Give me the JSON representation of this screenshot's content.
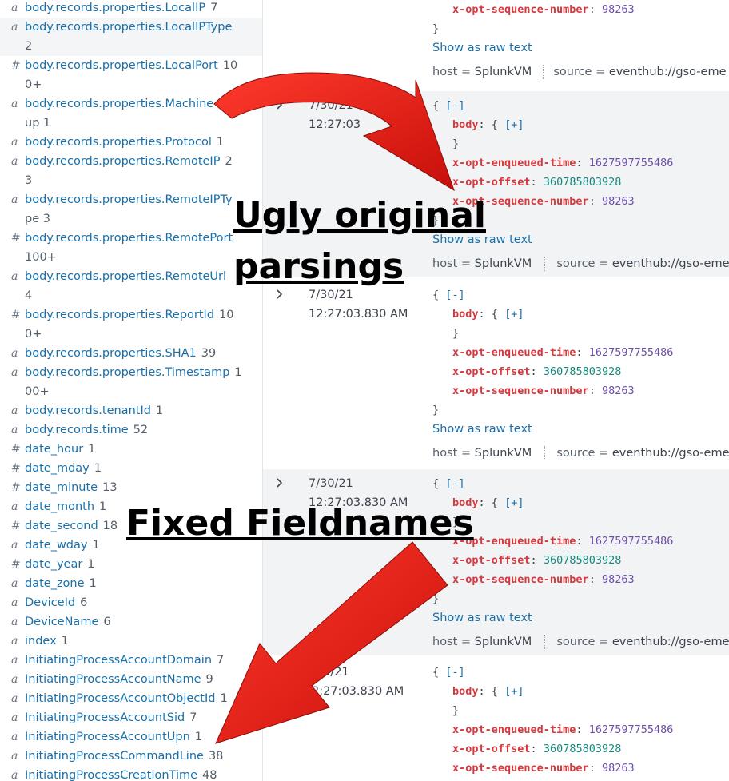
{
  "sidebar": {
    "fields": [
      {
        "type": "a",
        "name": "body.records.properties.LocalIP",
        "count": "7"
      },
      {
        "type": "a",
        "name": "body.records.properties.LocalIPType",
        "count": "",
        "cont": "2",
        "highlight": true
      },
      {
        "type": "#",
        "name": "body.records.properties.LocalPort",
        "count": "10",
        "cont": "0+"
      },
      {
        "type": "a",
        "name": "body.records.properties.Machine",
        "count": "o",
        "cont": "up 1"
      },
      {
        "type": "a",
        "name": "body.records.properties.Protocol",
        "count": "1"
      },
      {
        "type": "a",
        "name": "body.records.properties.RemoteIP",
        "count": "2",
        "cont": "3"
      },
      {
        "type": "a",
        "name": "body.records.properties.RemoteIPTy",
        "count": "",
        "cont": "pe 3"
      },
      {
        "type": "#",
        "name": "body.records.properties.RemotePort",
        "count": "",
        "cont": "100+"
      },
      {
        "type": "a",
        "name": "body.records.properties.RemoteUrl",
        "count": "",
        "cont": "4"
      },
      {
        "type": "#",
        "name": "body.records.properties.ReportId",
        "count": "10",
        "cont": "0+"
      },
      {
        "type": "a",
        "name": "body.records.properties.SHA1",
        "count": "39"
      },
      {
        "type": "a",
        "name": "body.records.properties.Timestamp",
        "count": "1",
        "cont": "00+"
      },
      {
        "type": "a",
        "name": "body.records.tenantId",
        "count": "1"
      },
      {
        "type": "a",
        "name": "body.records.time",
        "count": "52"
      },
      {
        "type": "#",
        "name": "date_hour",
        "count": "1"
      },
      {
        "type": "#",
        "name": "date_mday",
        "count": "1"
      },
      {
        "type": "#",
        "name": "date_minute",
        "count": "13"
      },
      {
        "type": "a",
        "name": "date_month",
        "count": "1"
      },
      {
        "type": "#",
        "name": "date_second",
        "count": "18"
      },
      {
        "type": "a",
        "name": "date_wday",
        "count": "1"
      },
      {
        "type": "#",
        "name": "date_year",
        "count": "1"
      },
      {
        "type": "a",
        "name": "date_zone",
        "count": "1"
      },
      {
        "type": "a",
        "name": "DeviceId",
        "count": "6"
      },
      {
        "type": "a",
        "name": "DeviceName",
        "count": "6"
      },
      {
        "type": "a",
        "name": "index",
        "count": "1"
      },
      {
        "type": "a",
        "name": "InitiatingProcessAccountDomain",
        "count": "7"
      },
      {
        "type": "a",
        "name": "InitiatingProcessAccountName",
        "count": "9"
      },
      {
        "type": "a",
        "name": "InitiatingProcessAccountObjectId",
        "count": "1"
      },
      {
        "type": "a",
        "name": "InitiatingProcessAccountSid",
        "count": "7"
      },
      {
        "type": "a",
        "name": "InitiatingProcessAccountUpn",
        "count": "1"
      },
      {
        "type": "a",
        "name": "InitiatingProcessCommandLine",
        "count": "38"
      },
      {
        "type": "a",
        "name": "InitiatingProcessCreationTime",
        "count": "48"
      }
    ]
  },
  "events": {
    "date": "7/30/21",
    "time": "12:27:03.830 AM",
    "time_partial": "12:27:03",
    "date_partial": "/30/21",
    "time_partial2": "2:27:03.830 AM",
    "open_brace": "{",
    "close_brace": "}",
    "collapse": "[-]",
    "expand": "[+]",
    "body_key": "body",
    "colon": ":",
    "enqueued_key": "x-opt-enqueued-time",
    "enqueued_val": "1627597755486",
    "offset_key": "x-opt-offset",
    "offset_val": "360785803928",
    "seq_key": "x-opt-sequence-number",
    "seq_val": "98263",
    "show_raw": "Show as raw text",
    "host_label": "host =",
    "host_value": "SplunkVM",
    "source_label": "source =",
    "source_value": "eventhub://gso-eme"
  },
  "annotations": {
    "top": [
      "Ugly original",
      "parsings"
    ],
    "bottom": "Fixed Fieldnames"
  },
  "colors": {
    "arrow_red": "#e0201a",
    "link": "#1a6fa8",
    "json_key": "#d7383e",
    "numeric_value": "#6d4ea8",
    "offset_value": "#148a7d"
  }
}
